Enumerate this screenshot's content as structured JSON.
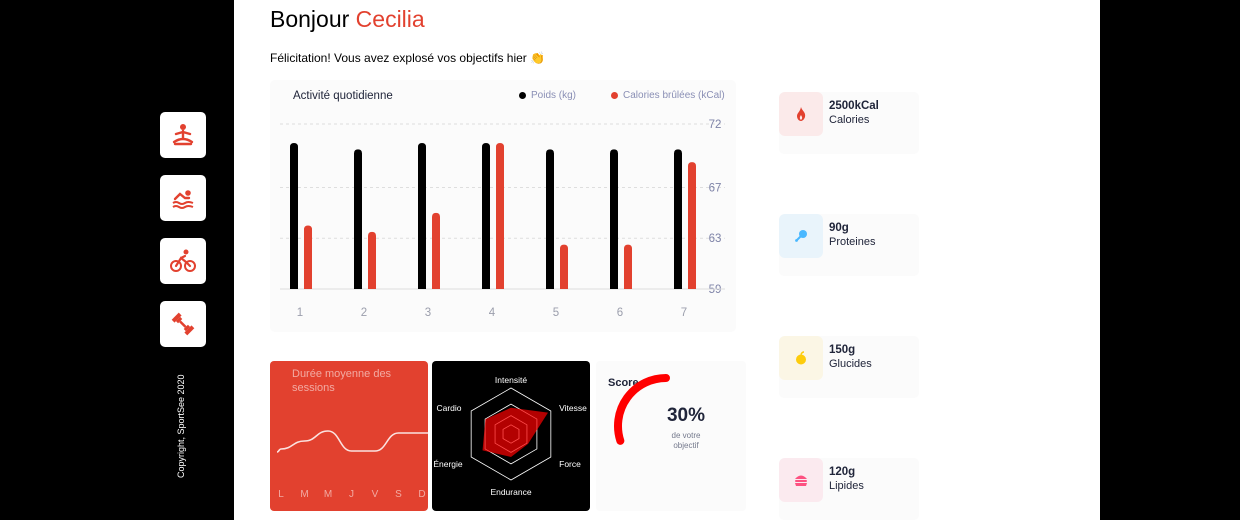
{
  "greeting": {
    "prefix": "Bonjour",
    "name": "Cecilia"
  },
  "message": "Félicitation! Vous avez explosé vos objectifs hier 👏",
  "sidebar": {
    "items": [
      {
        "icon": "yoga-icon"
      },
      {
        "icon": "swimming-icon"
      },
      {
        "icon": "cycling-icon"
      },
      {
        "icon": "dumbbell-icon"
      }
    ],
    "copyright": "Copyright, SportSee 2020"
  },
  "activity": {
    "title": "Activité quotidienne",
    "legend": {
      "weight": "Poids (kg)",
      "calories": "Calories brûlées (kCal)"
    }
  },
  "kpis": [
    {
      "value": "2500kCal",
      "label": "Calories",
      "icon": "flame-icon",
      "color": "#fbeaea"
    },
    {
      "value": "90g",
      "label": "Proteines",
      "icon": "chicken-leg-icon",
      "color": "#e9f4fb"
    },
    {
      "value": "150g",
      "label": "Glucides",
      "icon": "apple-icon",
      "color": "#fbf6e5"
    },
    {
      "value": "120g",
      "label": "Lipides",
      "icon": "burger-icon",
      "color": "#fbeaef"
    }
  ],
  "sessions": {
    "title": "Durée moyenne des sessions"
  },
  "score": {
    "title": "Score",
    "value": "30%",
    "sub1": "de votre",
    "sub2": "objectif"
  },
  "colors": {
    "accent": "#e2412f",
    "dark": "#282d30",
    "label": "#9b9eac"
  },
  "chart_data": [
    {
      "type": "bar",
      "title": "Activité quotidienne",
      "categories": [
        "1",
        "2",
        "3",
        "4",
        "5",
        "6",
        "7"
      ],
      "series": [
        {
          "name": "Poids (kg)",
          "values": [
            70.5,
            70,
            70.5,
            70.5,
            70,
            70,
            70
          ]
        },
        {
          "name": "Calories brûlées (kCal)",
          "values": [
            64,
            63.5,
            65,
            70.5,
            62.5,
            62.5,
            69
          ]
        }
      ],
      "ytick_labels": [
        "72",
        "67",
        "63",
        "59"
      ],
      "ylim": [
        59,
        72
      ],
      "grid": true,
      "legend_position": "top-right"
    },
    {
      "type": "line",
      "title": "Durée moyenne des sessions",
      "categories": [
        "L",
        "M",
        "M",
        "J",
        "V",
        "S",
        "D"
      ],
      "values": [
        22,
        30,
        40,
        20,
        20,
        38,
        38
      ]
    },
    {
      "type": "radar",
      "axes": [
        "Intensité",
        "Vitesse",
        "Force",
        "Endurance",
        "Énergie",
        "Cardio"
      ],
      "values": [
        80,
        130,
        60,
        70,
        100,
        90
      ],
      "max": 140
    },
    {
      "type": "pie",
      "title": "Score",
      "value": 0.3
    }
  ]
}
